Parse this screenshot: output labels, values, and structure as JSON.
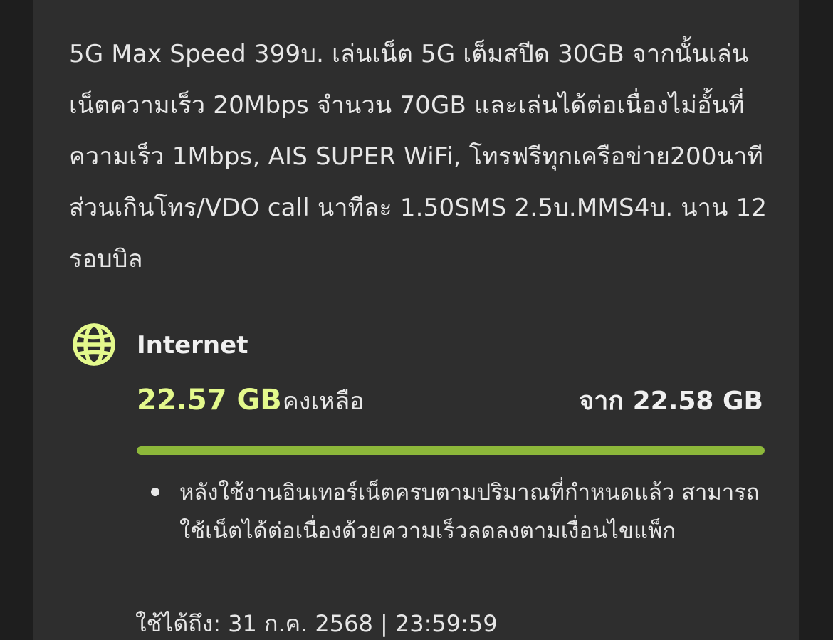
{
  "package": {
    "description": "5G Max Speed 399บ. เล่นเน็ต 5G เต็มสปีด 30GB จากนั้นเล่นเน็ตความเร็ว 20Mbps จำนวน 70GB และเล่นได้ต่อเนื่องไม่อั้นที่ความเร็ว 1Mbps, AIS SUPER WiFi, โทรฟรีทุกเครือข่าย200นาที ส่วนเกินโทร/VDO call นาทีละ 1.50SMS 2.5บ.MMS4บ. นาน 12 รอบบิล"
  },
  "internet": {
    "icon": "globe-icon",
    "title": "Internet",
    "remaining_value": "22.57 GB",
    "remaining_label": "คงเหลือ",
    "total_label": "จาก 22.58 GB",
    "progress_fraction": 0.9996,
    "accent_color": "#e4f98c",
    "bar_color": "#8db83a",
    "note": "หลังใช้งานอินเทอร์เน็ตครบตามปริมาณที่กำหนดแล้ว สามารถใช้เน็ตได้ต่อเนื่องด้วยความเร็วลดลงตามเงื่อนไขแพ็ก",
    "expiry": "ใช้ได้ถึง: 31 ก.ค. 2568 | 23:59:59"
  }
}
